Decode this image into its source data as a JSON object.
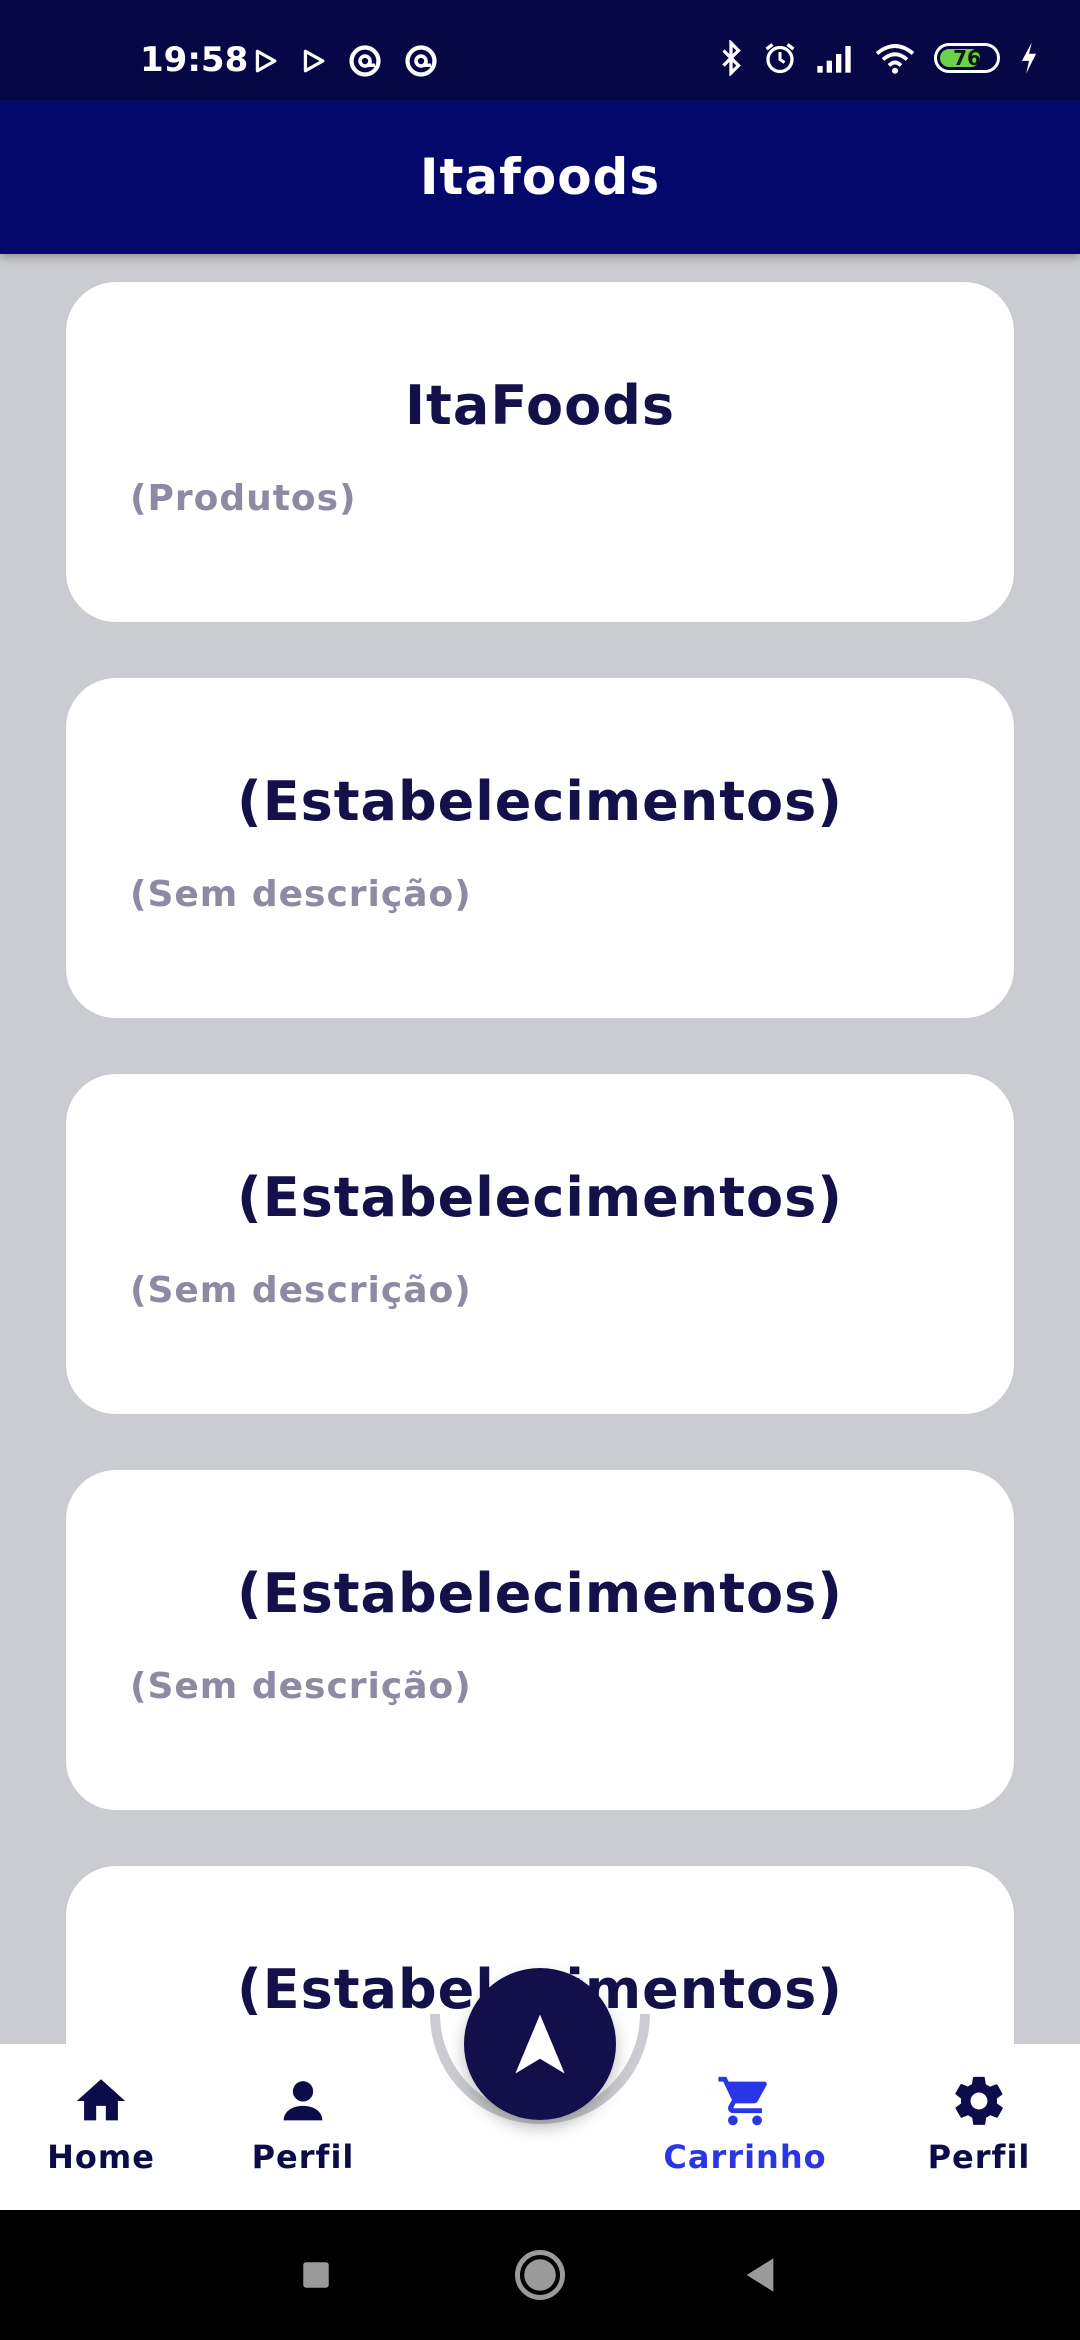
{
  "status_bar": {
    "time": "19:58",
    "battery_level": "76",
    "battery_percent": 76,
    "left_icons": [
      "play-icon",
      "play-icon",
      "at-sign-icon",
      "at-sign-icon"
    ],
    "right_icons": [
      "bluetooth-icon",
      "alarm-icon",
      "signal-icon",
      "wifi-icon",
      "battery-icon",
      "charging-icon"
    ]
  },
  "app_bar": {
    "title": "Itafoods"
  },
  "cards": [
    {
      "title": "ItaFoods",
      "subtitle": "(Produtos)"
    },
    {
      "title": "(Estabelecimentos)",
      "subtitle": "(Sem descrição)"
    },
    {
      "title": "(Estabelecimentos)",
      "subtitle": "(Sem descrição)"
    },
    {
      "title": "(Estabelecimentos)",
      "subtitle": "(Sem descrição)"
    },
    {
      "title": "(Estabelecimentos)",
      "subtitle": ""
    }
  ],
  "bottom_nav": {
    "items": [
      {
        "label": "Home",
        "icon": "home-icon",
        "active": false
      },
      {
        "label": "Perfil",
        "icon": "person-icon",
        "active": false
      },
      {
        "label": "Carrinho",
        "icon": "cart-icon",
        "active": true
      },
      {
        "label": "Perfil",
        "icon": "gear-icon",
        "active": false
      }
    ],
    "fab_icon": "navigation-arrow-icon"
  },
  "colors": {
    "status_bar": "#050844",
    "app_bar": "#04086b",
    "background": "#cbccd1",
    "card_title": "#14104a",
    "card_subtitle": "#8d8aa3",
    "nav_active": "#2a35e6",
    "nav_default": "#0c0c4a",
    "fab": "#130f4b"
  },
  "system_nav": {
    "buttons": [
      "recents-icon",
      "home-circle-icon",
      "back-icon"
    ]
  }
}
